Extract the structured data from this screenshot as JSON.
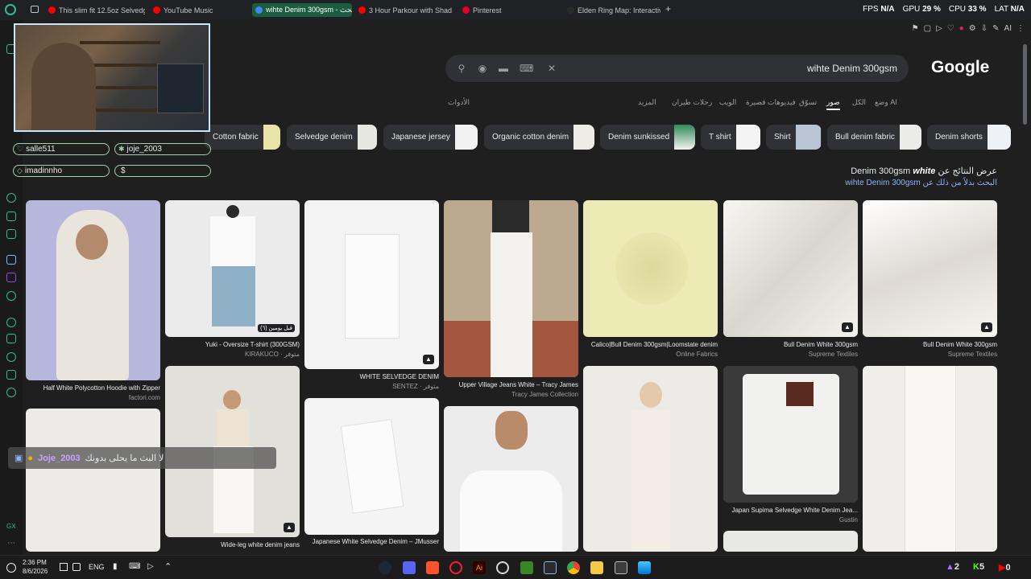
{
  "browser": {
    "tabs": [
      {
        "label": "This slim fit 12.5oz Selvedg",
        "color": "#ff0000",
        "active": false
      },
      {
        "label": "YouTube Music",
        "color": "#ff0000",
        "active": false
      },
      {
        "label": "wihte Denim 300gsm - بحث",
        "color": "#4285f4",
        "active": true
      },
      {
        "label": "3 Hour Parkour with Shad",
        "color": "#ff0000",
        "active": false
      },
      {
        "label": "Pinterest",
        "color": "#e60023",
        "active": false
      },
      {
        "label": "Elden Ring Map: Interactive",
        "color": "#2b2b2b",
        "active": false
      }
    ],
    "new_tab": "+",
    "stats": {
      "fps_label": "FPS",
      "fps_value": "N/A",
      "gpu_label": "GPU",
      "gpu_value": "29 %",
      "cpu_label": "CPU",
      "cpu_value": "33 %",
      "lat_label": "LAT",
      "lat_value": "N/A"
    },
    "toolbar_ai": "AI"
  },
  "stream_chips": [
    {
      "icon": "heart",
      "label": "salle511"
    },
    {
      "icon": "star",
      "label": "joje_2003"
    },
    {
      "icon": "diamond",
      "label": "imadinnho"
    },
    {
      "icon": "dollar",
      "label": "$"
    }
  ],
  "google": {
    "logo": "Google",
    "query": "wihte Denim 300gsm",
    "nav": [
      "وضع AI",
      "الكل",
      "صور",
      "تسوّق",
      "فيديوهات قصيرة",
      "الويب",
      "رحلات طيران",
      "المزيد",
      "الأدوات"
    ],
    "active_nav": "صور",
    "related": [
      {
        "label": "Cotton fabric",
        "thumb": "#e9e4a6"
      },
      {
        "label": "Selvedge denim",
        "thumb": "#e7e7e2"
      },
      {
        "label": "Japanese jersey",
        "thumb": "#f2f2f2"
      },
      {
        "label": "Organic cotton denim",
        "thumb": "#eeece7"
      },
      {
        "label": "Denim sunkissed",
        "thumb": "#2e8b57"
      },
      {
        "label": "T shirt",
        "thumb": "#f4f4f4"
      },
      {
        "label": "Shirt",
        "thumb": "#b9c5d4"
      },
      {
        "label": "Bull denim fabric",
        "thumb": "#ebebea"
      },
      {
        "label": "Denim shorts",
        "thumb": "#eef2f6"
      }
    ],
    "showing_prefix": "عرض النتائج عن",
    "showing_bold": "white",
    "showing_rest": "Denim 300gsm",
    "instead_prefix": "البحث بدلاً من ذلك عن",
    "instead_query": "wihte Denim 300gsm"
  },
  "results": [
    {
      "caption": "Half White Polycotton Hoodie with Zipper",
      "source": "factori.com",
      "bg": "#b7b6dc"
    },
    {
      "caption": "",
      "source": "",
      "bg": "#ecebe8"
    },
    {
      "caption": "Yuki - Oversize T-shirt (300GSM)",
      "source": "KIRAKUCO · متوفر",
      "bg": "#ebebeb",
      "badge": "قبل يومين (٦)"
    },
    {
      "caption": "Wide-leg white denim jeans",
      "source": "",
      "bg": "#e2e0da"
    },
    {
      "caption": "WHITE SELVEDGE DENIM",
      "source": "SENTEZ · متوفر",
      "bg": "#f3f3f3"
    },
    {
      "caption": "Japanese White Selvedge Denim – JMusser",
      "source": "",
      "bg": "#f4f4f4"
    },
    {
      "caption": "Upper Village Jeans White – Tracy James",
      "source": "Tracy James Collection",
      "bg": "#bda98f"
    },
    {
      "caption": "",
      "source": "",
      "bg": "#ececec"
    },
    {
      "caption": "Calico|Bull Denim 300gsm|Loomstate denim",
      "source": "Online Fabrics",
      "bg": "#ecebb5"
    },
    {
      "caption": "",
      "source": "",
      "bg": "#ecebe7"
    },
    {
      "caption": "Bull Denim White 300gsm",
      "source": "Supreme Textiles",
      "bg": "#eeece6"
    },
    {
      "caption": "Japan Supima Selvedge White Denim Jea...",
      "source": "Gustin",
      "bg": "#e8e8e6"
    },
    {
      "caption": "Bull Denim White 300gsm",
      "source": "Supreme Textiles",
      "bg": "#f3f1ec"
    },
    {
      "caption": "",
      "source": "",
      "bg": "#efeeea"
    }
  ],
  "chat_overlay": {
    "user": "Joje_2003",
    "message": "لا البث ما يحلى بدونك"
  },
  "taskbar": {
    "time": "2:36 PM",
    "date": "8/6/2026",
    "lang": "ENG",
    "counters": [
      {
        "icon": "party",
        "value": "2"
      },
      {
        "icon": "kick",
        "value": "5"
      },
      {
        "icon": "youtube",
        "value": "0"
      }
    ],
    "apps": [
      "steam",
      "discord",
      "brave",
      "opera-gx",
      "illustrator",
      "obs",
      "minecraft",
      "store",
      "chrome",
      "files",
      "task-view",
      "windows"
    ]
  }
}
